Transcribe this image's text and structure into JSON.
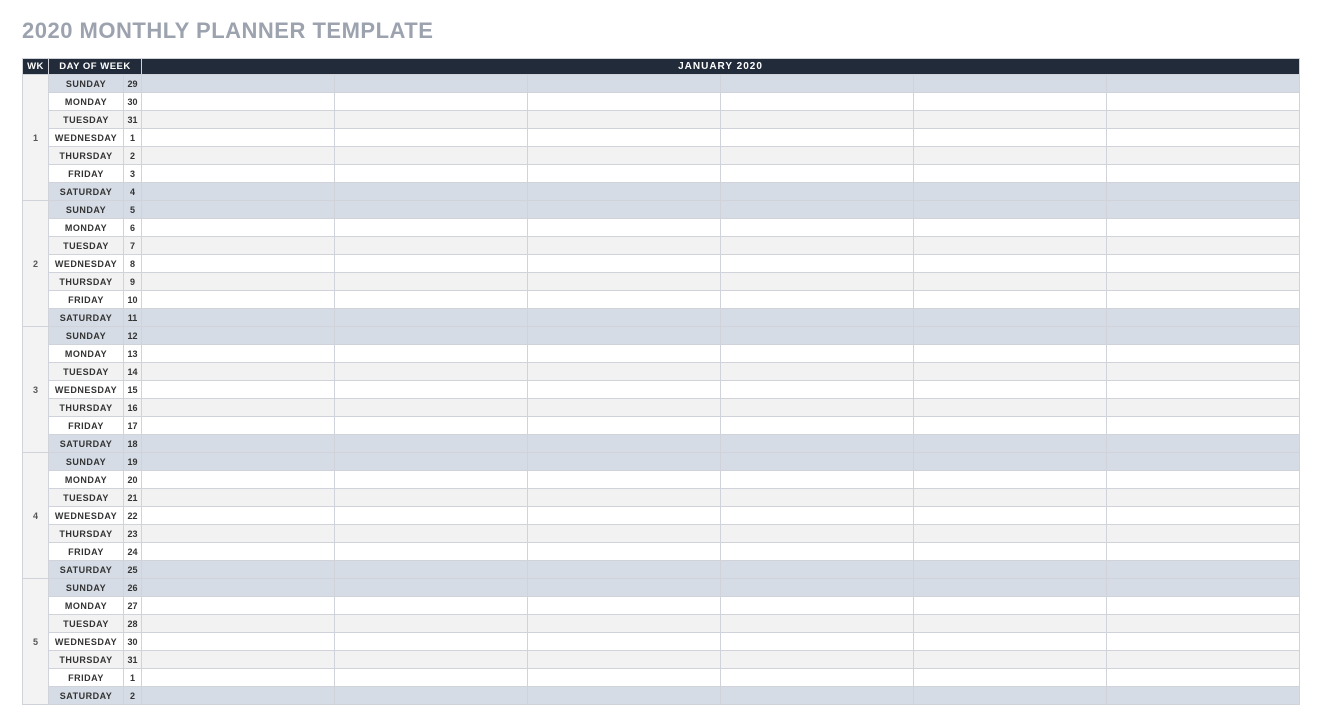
{
  "title": "2020 MONTHLY PLANNER TEMPLATE",
  "header": {
    "wk": "WK",
    "dow": "DAY OF WEEK",
    "month": "JANUARY 2020"
  },
  "task_columns": 6,
  "weeks": [
    {
      "num": "1",
      "days": [
        {
          "dow": "SUNDAY",
          "date": "29",
          "weekend": true
        },
        {
          "dow": "MONDAY",
          "date": "30"
        },
        {
          "dow": "TUESDAY",
          "date": "31"
        },
        {
          "dow": "WEDNESDAY",
          "date": "1"
        },
        {
          "dow": "THURSDAY",
          "date": "2"
        },
        {
          "dow": "FRIDAY",
          "date": "3"
        },
        {
          "dow": "SATURDAY",
          "date": "4",
          "weekend": true
        }
      ]
    },
    {
      "num": "2",
      "days": [
        {
          "dow": "SUNDAY",
          "date": "5",
          "weekend": true
        },
        {
          "dow": "MONDAY",
          "date": "6"
        },
        {
          "dow": "TUESDAY",
          "date": "7"
        },
        {
          "dow": "WEDNESDAY",
          "date": "8"
        },
        {
          "dow": "THURSDAY",
          "date": "9"
        },
        {
          "dow": "FRIDAY",
          "date": "10"
        },
        {
          "dow": "SATURDAY",
          "date": "11",
          "weekend": true
        }
      ]
    },
    {
      "num": "3",
      "days": [
        {
          "dow": "SUNDAY",
          "date": "12",
          "weekend": true
        },
        {
          "dow": "MONDAY",
          "date": "13"
        },
        {
          "dow": "TUESDAY",
          "date": "14"
        },
        {
          "dow": "WEDNESDAY",
          "date": "15"
        },
        {
          "dow": "THURSDAY",
          "date": "16"
        },
        {
          "dow": "FRIDAY",
          "date": "17"
        },
        {
          "dow": "SATURDAY",
          "date": "18",
          "weekend": true
        }
      ]
    },
    {
      "num": "4",
      "days": [
        {
          "dow": "SUNDAY",
          "date": "19",
          "weekend": true
        },
        {
          "dow": "MONDAY",
          "date": "20"
        },
        {
          "dow": "TUESDAY",
          "date": "21"
        },
        {
          "dow": "WEDNESDAY",
          "date": "22"
        },
        {
          "dow": "THURSDAY",
          "date": "23"
        },
        {
          "dow": "FRIDAY",
          "date": "24"
        },
        {
          "dow": "SATURDAY",
          "date": "25",
          "weekend": true
        }
      ]
    },
    {
      "num": "5",
      "days": [
        {
          "dow": "SUNDAY",
          "date": "26",
          "weekend": true
        },
        {
          "dow": "MONDAY",
          "date": "27"
        },
        {
          "dow": "TUESDAY",
          "date": "28"
        },
        {
          "dow": "WEDNESDAY",
          "date": "30"
        },
        {
          "dow": "THURSDAY",
          "date": "31"
        },
        {
          "dow": "FRIDAY",
          "date": "1"
        },
        {
          "dow": "SATURDAY",
          "date": "2",
          "weekend": true
        }
      ]
    }
  ]
}
